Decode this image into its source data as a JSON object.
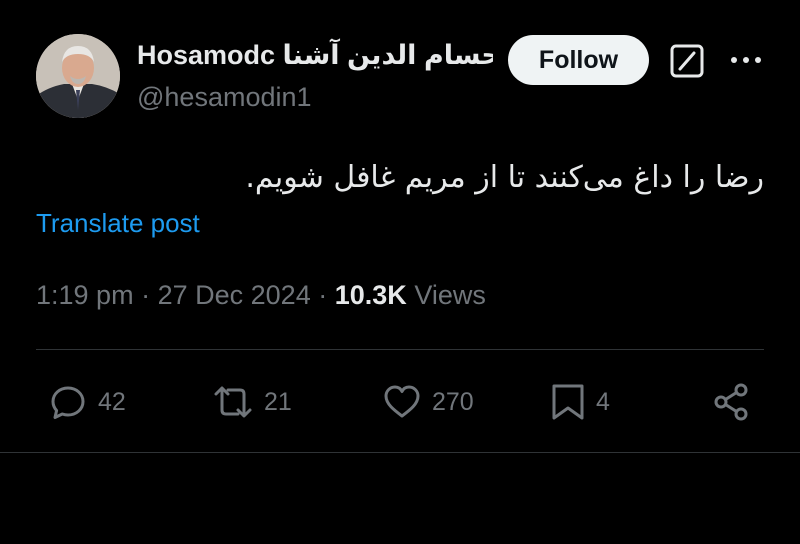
{
  "author": {
    "display_name": "Hosamodc حسام الدين آشنا",
    "handle": "@hesamodin1",
    "avatar": "avatar-photo"
  },
  "header": {
    "follow_label": "Follow",
    "icons": [
      "grok-icon",
      "more-icon"
    ]
  },
  "post": {
    "text": "رضا را داغ می‌کنند تا از مریم غافل شویم.",
    "translate_label": "Translate post",
    "time": "1:19 pm",
    "separator": "·",
    "date": "27 Dec 2024",
    "views_count": "10.3K",
    "views_label": "Views"
  },
  "actions": {
    "reply": {
      "icon": "reply-icon",
      "count": "42"
    },
    "repost": {
      "icon": "repost-icon",
      "count": "21"
    },
    "like": {
      "icon": "heart-icon",
      "count": "270"
    },
    "bookmark": {
      "icon": "bookmark-icon",
      "count": "4"
    },
    "share": {
      "icon": "share-icon"
    }
  },
  "colors": {
    "background": "#000000",
    "text_primary": "#e7e9ea",
    "text_secondary": "#71767b",
    "link": "#1d9bf0",
    "follow_button_bg": "#eff3f4",
    "divider": "#2f3336"
  }
}
